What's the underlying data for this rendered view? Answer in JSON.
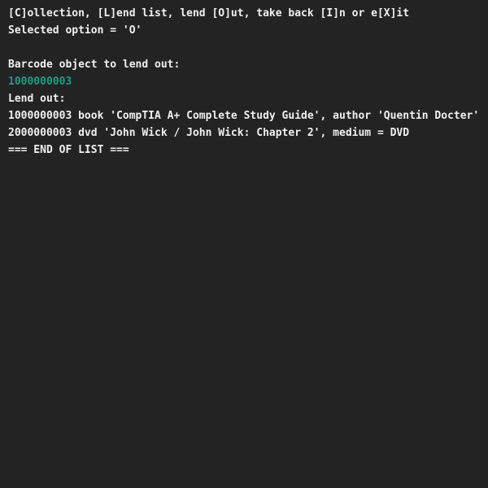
{
  "terminal": {
    "menu_prompt": "[C]ollection, [L]end list, lend [O]ut, take back [I]n or e[X]it",
    "selected_option": "Selected option = 'O'",
    "barcode_prompt": "Barcode object to lend out:",
    "barcode_input": "1000000003",
    "lend_out_header": "Lend out:",
    "list_items": [
      "1000000003 book 'CompTIA A+ Complete Study Guide', author 'Quentin Docter'",
      "2000000003 dvd 'John Wick / John Wick: Chapter 2', medium = DVD"
    ],
    "end_of_list": "=== END OF LIST ==="
  },
  "colors": {
    "background": "#232323",
    "text": "#f0f0f0",
    "input_echo": "#1f9b82"
  }
}
